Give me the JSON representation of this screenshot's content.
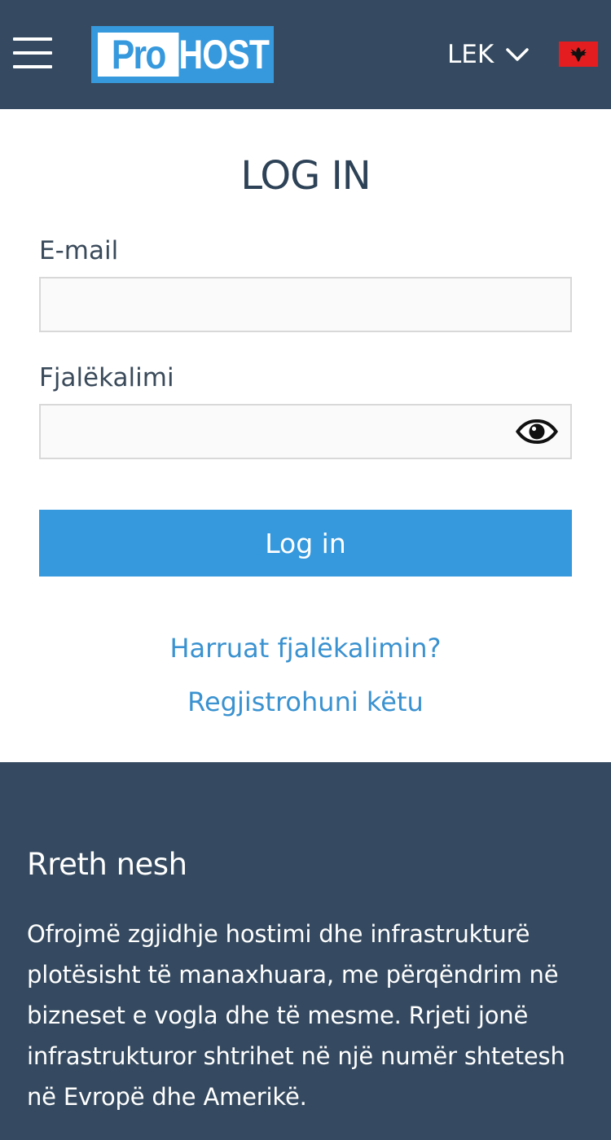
{
  "header": {
    "logo": {
      "part1": "Pro",
      "part2": "HOST"
    },
    "currency": "LEK",
    "flag_color": "#e41e20",
    "bg_color": "#354a60"
  },
  "login": {
    "title": "LOG IN",
    "email_label": "E-mail",
    "email_value": "",
    "password_label": "Fjalëkalimi",
    "password_value": "",
    "submit_label": "Log in",
    "forgot_link": "Harruat fjalëkalimin?",
    "register_link": "Regjistrohuni këtu",
    "accent_color": "#3699dd"
  },
  "about": {
    "title": "Rreth nesh",
    "text": "Ofrojmë zgjidhje hostimi dhe infrastrukturë plotësisht të manaxhuara, me përqëndrim në bizneset e vogla dhe të mesme. Rrjeti jonë infrastrukturor shtrihet në një numër shtetesh në Evropë dhe Amerikë."
  },
  "icons": {
    "menu": "hamburger-menu-icon",
    "currency_toggle": "chevron-down-icon",
    "password_toggle": "eye-icon",
    "flag": "albania-flag-icon"
  }
}
